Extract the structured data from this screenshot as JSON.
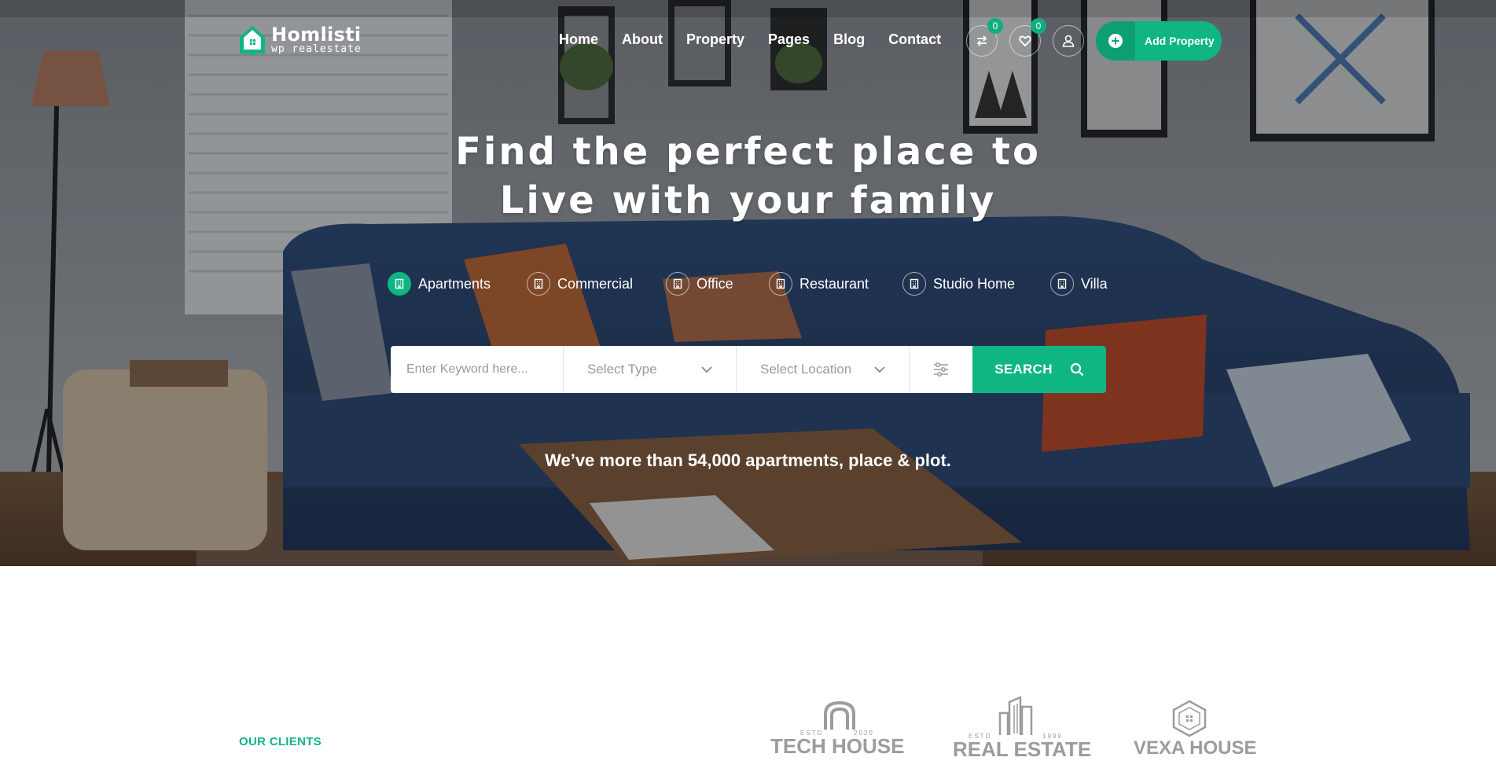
{
  "brand": {
    "name": "Homlisti",
    "tagline": "wp realestate",
    "accent_color": "#10b584"
  },
  "nav": {
    "items": [
      {
        "label": "Home"
      },
      {
        "label": "About"
      },
      {
        "label": "Property"
      },
      {
        "label": "Pages"
      },
      {
        "label": "Blog"
      },
      {
        "label": "Contact"
      }
    ]
  },
  "header_actions": {
    "compare": {
      "icon": "compare-arrows-icon",
      "count": "0"
    },
    "favorites": {
      "icon": "heart-icon",
      "count": "0"
    },
    "account": {
      "icon": "user-icon"
    },
    "add_property": {
      "icon": "plus-circle-icon",
      "label": "Add Property"
    }
  },
  "hero": {
    "headline_line1": "Find the perfect place to",
    "headline_line2": "Live with your family",
    "tagline": "We’ve more than 54,000 apartments, place & plot."
  },
  "property_types": {
    "selected": "Apartments",
    "items": [
      {
        "label": "Apartments",
        "icon": "building-icon"
      },
      {
        "label": "Commercial",
        "icon": "building-icon"
      },
      {
        "label": "Office",
        "icon": "building-icon"
      },
      {
        "label": "Restaurant",
        "icon": "building-icon"
      },
      {
        "label": "Studio Home",
        "icon": "building-icon"
      },
      {
        "label": "Villa",
        "icon": "building-icon"
      }
    ]
  },
  "search": {
    "keyword_placeholder": "Enter Keyword here...",
    "type_select": "Select Type",
    "location_select": "Select Location",
    "filter_icon": "sliders-icon",
    "button_label": "SEARCH",
    "button_icon": "search-icon"
  },
  "clients": {
    "section_label": "OUR CLIENTS",
    "logos": [
      {
        "name": "TECH HOUSE",
        "estd": "ESTD",
        "year": "2020"
      },
      {
        "name": "REAL ESTATE",
        "estd": "ESTD",
        "year": "1999"
      },
      {
        "name": "VEXA HOUSE"
      }
    ]
  }
}
